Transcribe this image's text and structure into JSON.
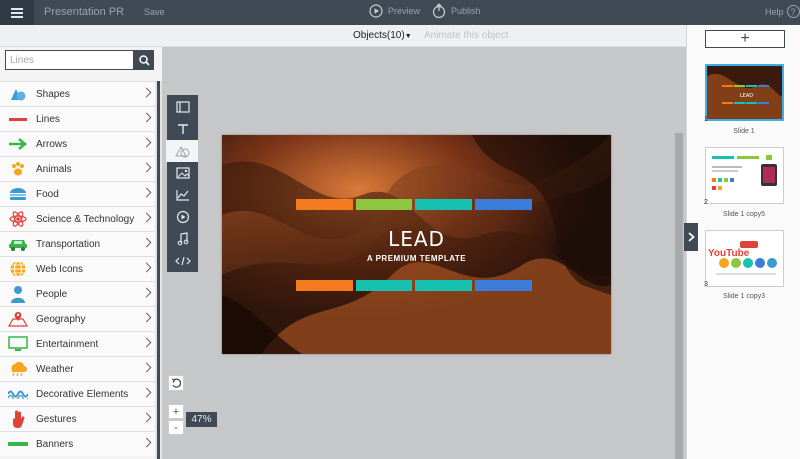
{
  "topbar": {
    "app_title": "Presentation PR",
    "save_label": "Save",
    "preview_label": "Preview",
    "publish_label": "Publish",
    "help_label": "Help",
    "help_glyph": "?"
  },
  "subbar": {
    "objects_label": "Objects(10)",
    "animate_label": "Animate this object"
  },
  "search": {
    "placeholder": "Lines"
  },
  "categories": [
    {
      "label": "Shapes",
      "icon": "shapes-icon",
      "color": "#3d9ad1"
    },
    {
      "label": "Lines",
      "icon": "line-icon",
      "color": "#e0413a"
    },
    {
      "label": "Arrows",
      "icon": "arrow-icon",
      "color": "#39b54a"
    },
    {
      "label": "Animals",
      "icon": "paw-icon",
      "color": "#f7a51c"
    },
    {
      "label": "Food",
      "icon": "burger-icon",
      "color": "#3d9ad1"
    },
    {
      "label": "Science & Technology",
      "icon": "atom-icon",
      "color": "#e0413a"
    },
    {
      "label": "Transportation",
      "icon": "car-icon",
      "color": "#39b54a"
    },
    {
      "label": "Web Icons",
      "icon": "globe-icon",
      "color": "#f7a51c"
    },
    {
      "label": "People",
      "icon": "person-icon",
      "color": "#3d9ad1"
    },
    {
      "label": "Geography",
      "icon": "map-icon",
      "color": "#e0413a"
    },
    {
      "label": "Entertainment",
      "icon": "monitor-icon",
      "color": "#39b54a"
    },
    {
      "label": "Weather",
      "icon": "cloud-rain-icon",
      "color": "#f7a51c"
    },
    {
      "label": "Decorative Elements",
      "icon": "wave-icon",
      "color": "#3d9ad1"
    },
    {
      "label": "Gestures",
      "icon": "hand-icon",
      "color": "#e0413a"
    },
    {
      "label": "Banners",
      "icon": "banner-icon",
      "color": "#39b54a"
    }
  ],
  "tools": [
    {
      "name": "background-tool-icon"
    },
    {
      "name": "text-tool-icon"
    },
    {
      "name": "shapes-tool-icon"
    },
    {
      "name": "image-tool-icon"
    },
    {
      "name": "chart-tool-icon"
    },
    {
      "name": "video-tool-icon"
    },
    {
      "name": "music-tool-icon"
    },
    {
      "name": "code-tool-icon"
    }
  ],
  "slide": {
    "title": "LEAD",
    "subtitle": "A PREMIUM TEMPLATE",
    "bar_colors_top": [
      "#f47b20",
      "#8dc63f",
      "#17c2b2",
      "#3b7dd8"
    ],
    "bar_colors_bottom": [
      "#f47b20",
      "#17c2b2",
      "#17c2b2",
      "#3b7dd8"
    ]
  },
  "zoom": {
    "level": "47%",
    "in_label": "+",
    "out_label": "-"
  },
  "add_slide_label": "+",
  "thumbnails": [
    {
      "num": "1",
      "label": "Slide 1",
      "selected": true
    },
    {
      "num": "2",
      "label": "Slide 1 copy5",
      "selected": false
    },
    {
      "num": "3",
      "label": "Slide 1 copy3",
      "selected": false
    }
  ],
  "thumb1": {
    "title": "LEAD"
  },
  "thumb3": {
    "word": "YouTube"
  }
}
